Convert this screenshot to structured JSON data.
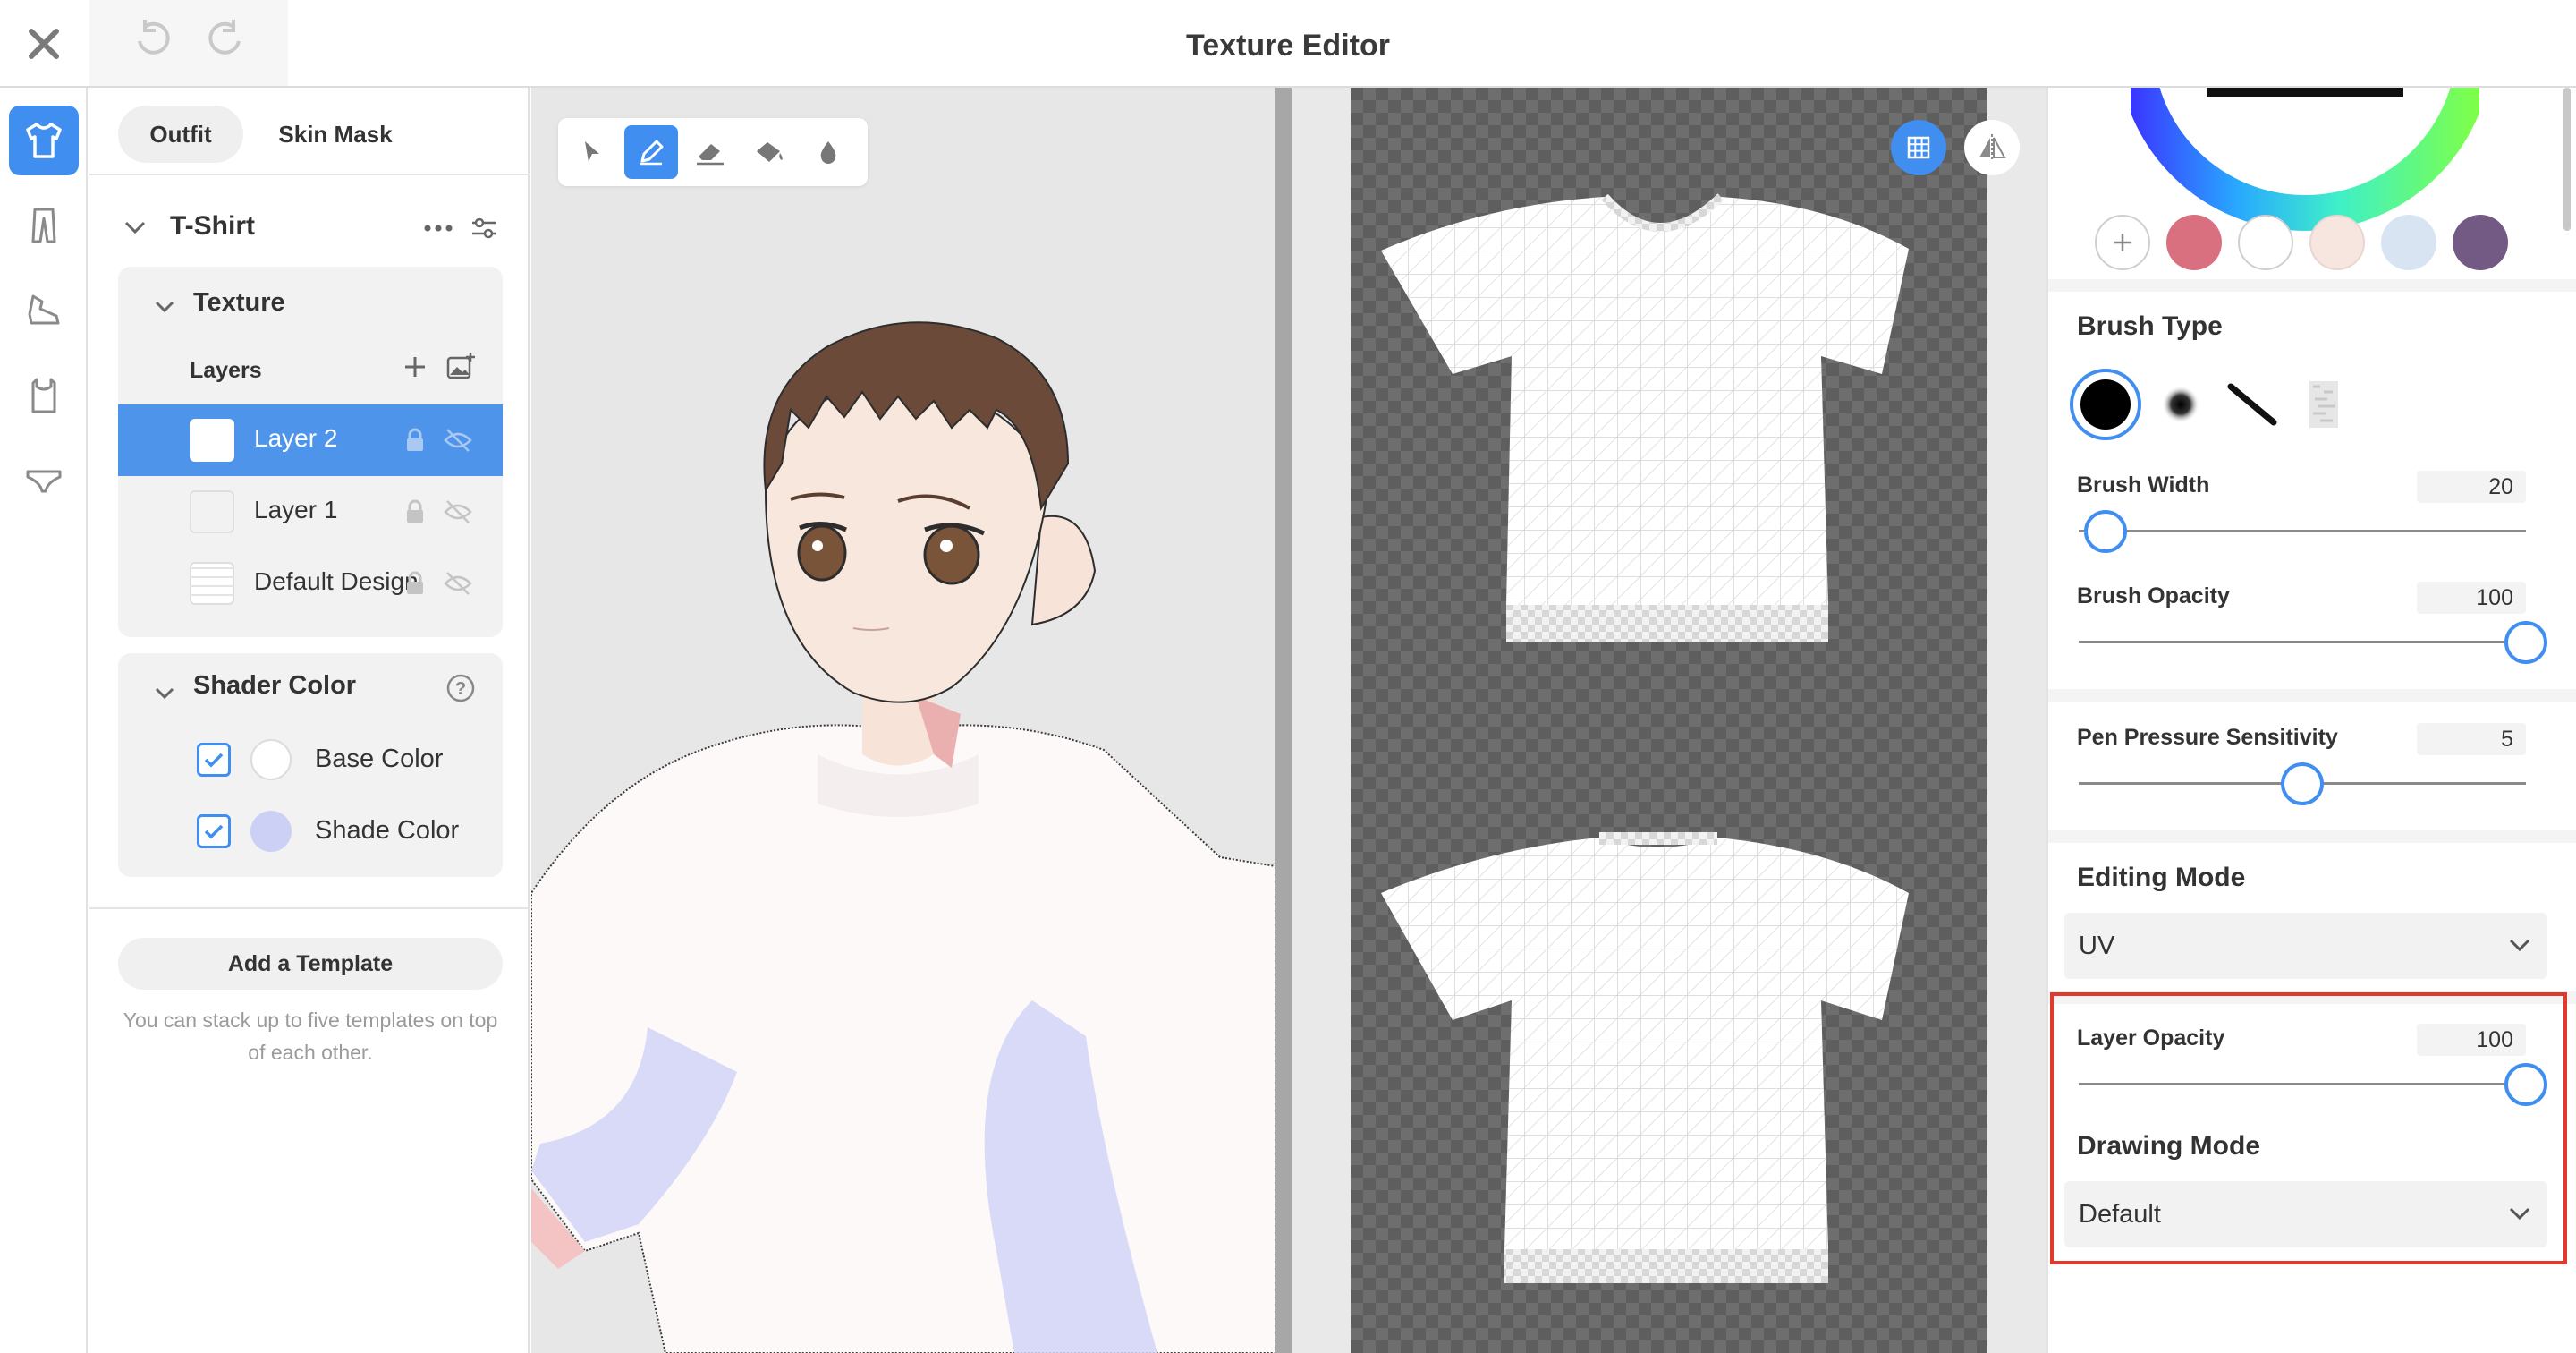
{
  "window": {
    "title": "Texture Editor"
  },
  "left_panel": {
    "tabs": [
      {
        "label": "Outfit"
      },
      {
        "label": "Skin Mask"
      }
    ],
    "item_title": "T-Shirt",
    "texture": {
      "title": "Texture",
      "layers_label": "Layers",
      "layers": [
        {
          "label": "Layer 2",
          "selected": true
        },
        {
          "label": "Layer 1",
          "selected": false
        },
        {
          "label": "Default Design",
          "selected": false
        }
      ]
    },
    "shader_color": {
      "title": "Shader Color",
      "items": [
        {
          "label": "Base Color",
          "checked": true,
          "color": "#ffffff"
        },
        {
          "label": "Shade Color",
          "checked": true,
          "color": "#cdd0f5"
        }
      ]
    },
    "template_button": "Add a Template",
    "template_hint": "You can stack up to five templates on top of each other."
  },
  "palette": {
    "swatches": [
      "#d9707f",
      "#ffffff",
      "#f7e6e0",
      "#d8e4f1",
      "#725a85"
    ]
  },
  "right_panel": {
    "brush_type": {
      "title": "Brush Type",
      "types": [
        "solid-brush-icon",
        "soft-brush-icon",
        "line-brush-icon",
        "texture-brush-icon"
      ]
    },
    "brush_width": {
      "label": "Brush Width",
      "value": "20",
      "fraction": 0.06
    },
    "brush_opacity": {
      "label": "Brush Opacity",
      "value": "100",
      "fraction": 1.0
    },
    "pen_pressure": {
      "label": "Pen Pressure Sensitivity",
      "value": "5",
      "fraction": 0.5
    },
    "editing_mode": {
      "title": "Editing Mode",
      "value": "UV"
    },
    "layer_opacity": {
      "label": "Layer Opacity",
      "value": "100",
      "fraction": 1.0
    },
    "drawing_mode": {
      "title": "Drawing Mode",
      "value": "Default"
    }
  },
  "colors": {
    "accent": "#3f8ef0",
    "highlight_border": "#e0392d"
  }
}
